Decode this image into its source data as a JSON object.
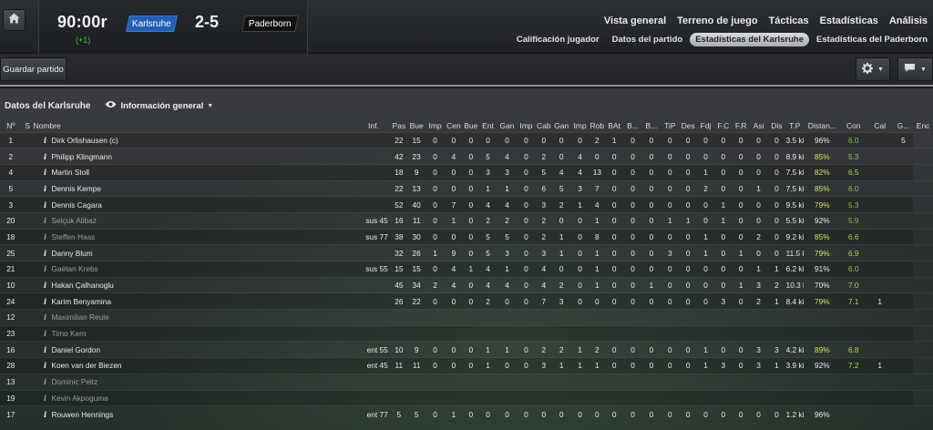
{
  "header": {
    "clock": "90:00r",
    "added_time": "(+1)",
    "home_team": "Karlsruhe",
    "away_team": "Paderborn",
    "score": "2-5",
    "main_nav": [
      "Vista general",
      "Terreno de juego",
      "Tácticas",
      "Estadísticas",
      "Análisis"
    ],
    "sub_nav": [
      "Calificación jugador",
      "Datos del partido",
      "Estadísticas del Karlsruhe",
      "Estadísticas del Paderborn"
    ],
    "active_sub_nav": "Estadísticas del Karlsruhe"
  },
  "toolbar": {
    "save_label": "Guardar partido"
  },
  "panel": {
    "title": "Datos del Karlsruhe",
    "view": "Información general"
  },
  "colors": {
    "home_team": "#1f5fb8",
    "away_team": "#111111",
    "added_time": "#45c43f",
    "rating": "#7ec84a"
  },
  "table": {
    "columns": [
      "Nº",
      "S",
      "Nombre",
      "Inf.",
      "Pas",
      "Bue",
      "Imp",
      "Cen",
      "Bue",
      "Ent",
      "Gan",
      "Imp",
      "Cab",
      "Gan",
      "Imp",
      "Rob",
      "BAt",
      "B...",
      "B...",
      "TiP",
      "Des",
      "Fdj",
      "F.C",
      "F.R",
      "Asi",
      "Dis",
      "T.P",
      "Distan...",
      "Con",
      "Cal",
      "G...",
      "Enc"
    ],
    "rows": [
      {
        "num": "1",
        "s": "",
        "name": "Dirk Orlishausen (c)",
        "info": "i",
        "inf": "",
        "stats": [
          "22",
          "15",
          "0",
          "0",
          "0",
          "0",
          "0",
          "0",
          "0",
          "0",
          "0",
          "2",
          "1",
          "0",
          "0",
          "0",
          "0",
          "0",
          "0",
          "0",
          "0",
          "0",
          "3.5 kiló...",
          "96%",
          "6.0",
          "",
          "5"
        ],
        "sub": false
      },
      {
        "num": "2",
        "s": "",
        "name": "Philipp Klingmann",
        "info": "i",
        "inf": "",
        "stats": [
          "42",
          "23",
          "0",
          "4",
          "0",
          "5",
          "4",
          "0",
          "2",
          "0",
          "4",
          "0",
          "0",
          "0",
          "0",
          "0",
          "0",
          "0",
          "0",
          "0",
          "0",
          "0",
          "8.9 kiló...",
          "85%",
          "5.3",
          "",
          ""
        ],
        "sub": false
      },
      {
        "num": "4",
        "s": "",
        "name": "Martin Stoll",
        "info": "i",
        "inf": "",
        "stats": [
          "18",
          "9",
          "0",
          "0",
          "0",
          "3",
          "3",
          "0",
          "5",
          "4",
          "4",
          "13",
          "0",
          "0",
          "0",
          "0",
          "0",
          "1",
          "0",
          "0",
          "0",
          "0",
          "7.5 kiló...",
          "82%",
          "6.5",
          "",
          ""
        ],
        "sub": false
      },
      {
        "num": "5",
        "s": "",
        "name": "Dennis Kempe",
        "info": "i",
        "inf": "",
        "stats": [
          "22",
          "13",
          "0",
          "0",
          "0",
          "1",
          "1",
          "0",
          "6",
          "5",
          "3",
          "7",
          "0",
          "0",
          "0",
          "0",
          "0",
          "2",
          "0",
          "0",
          "1",
          "0",
          "7.5 kiló...",
          "85%",
          "6.0",
          "",
          ""
        ],
        "sub": false
      },
      {
        "num": "3",
        "s": "",
        "name": "Dennis Cagara",
        "info": "i",
        "inf": "",
        "stats": [
          "52",
          "40",
          "0",
          "7",
          "0",
          "4",
          "4",
          "0",
          "3",
          "2",
          "1",
          "4",
          "0",
          "0",
          "0",
          "0",
          "0",
          "0",
          "1",
          "0",
          "0",
          "0",
          "9.5 kiló...",
          "79%",
          "5.3",
          "",
          ""
        ],
        "sub": false
      },
      {
        "num": "20",
        "s": "",
        "name": "Selçuk Alibaz",
        "info": "i",
        "inf": "sus 45",
        "stats": [
          "16",
          "11",
          "0",
          "1",
          "0",
          "2",
          "2",
          "0",
          "2",
          "0",
          "0",
          "1",
          "0",
          "0",
          "0",
          "1",
          "1",
          "0",
          "1",
          "0",
          "0",
          "0",
          "5.5 kiló...",
          "92%",
          "5.9",
          "",
          ""
        ],
        "sub": true
      },
      {
        "num": "18",
        "s": "",
        "name": "Steffen Haas",
        "info": "i",
        "inf": "sus 77",
        "stats": [
          "38",
          "30",
          "0",
          "0",
          "0",
          "5",
          "5",
          "0",
          "2",
          "1",
          "0",
          "8",
          "0",
          "0",
          "0",
          "0",
          "0",
          "1",
          "0",
          "0",
          "2",
          "0",
          "9.2 kiló...",
          "85%",
          "6.6",
          "",
          ""
        ],
        "sub": true
      },
      {
        "num": "25",
        "s": "",
        "name": "Danny Blum",
        "info": "i",
        "inf": "",
        "stats": [
          "32",
          "26",
          "1",
          "9",
          "0",
          "5",
          "3",
          "0",
          "3",
          "1",
          "0",
          "1",
          "0",
          "0",
          "0",
          "3",
          "0",
          "1",
          "0",
          "1",
          "0",
          "0",
          "11.5 kil...",
          "79%",
          "6.9",
          "",
          ""
        ],
        "sub": false
      },
      {
        "num": "21",
        "s": "",
        "name": "Gaëtan Krebs",
        "info": "i",
        "inf": "sus 55",
        "stats": [
          "15",
          "15",
          "0",
          "4",
          "1",
          "4",
          "1",
          "0",
          "4",
          "0",
          "0",
          "1",
          "0",
          "0",
          "0",
          "0",
          "0",
          "0",
          "0",
          "0",
          "1",
          "1",
          "6.2 kiló...",
          "91%",
          "6.0",
          "",
          ""
        ],
        "sub": true
      },
      {
        "num": "10",
        "s": "",
        "name": "Hakan Çalhanoglu",
        "info": "i",
        "inf": "",
        "stats": [
          "45",
          "34",
          "2",
          "4",
          "0",
          "4",
          "4",
          "0",
          "4",
          "2",
          "0",
          "1",
          "0",
          "0",
          "1",
          "0",
          "0",
          "0",
          "0",
          "1",
          "3",
          "2",
          "10.3 kil...",
          "70%",
          "7.0",
          "",
          ""
        ],
        "sub": false
      },
      {
        "num": "24",
        "s": "",
        "name": "Karim Benyamina",
        "info": "i",
        "inf": "",
        "stats": [
          "26",
          "22",
          "0",
          "0",
          "0",
          "2",
          "0",
          "0",
          "7",
          "3",
          "0",
          "0",
          "0",
          "0",
          "0",
          "0",
          "0",
          "0",
          "3",
          "0",
          "2",
          "1",
          "8.4 kiló...",
          "79%",
          "7.1",
          "1",
          ""
        ],
        "sub": false
      },
      {
        "num": "12",
        "s": "",
        "name": "Maximilian Reule",
        "info": "i",
        "inf": "",
        "stats": [
          "",
          "",
          "",
          "",
          "",
          "",
          "",
          "",
          "",
          "",
          "",
          "",
          "",
          "",
          "",
          "",
          "",
          "",
          "",
          "",
          "",
          "",
          "",
          "",
          "",
          "",
          ""
        ],
        "sub": true
      },
      {
        "num": "23",
        "s": "",
        "name": "Timo Kern",
        "info": "i",
        "inf": "",
        "stats": [
          "",
          "",
          "",
          "",
          "",
          "",
          "",
          "",
          "",
          "",
          "",
          "",
          "",
          "",
          "",
          "",
          "",
          "",
          "",
          "",
          "",
          "",
          "",
          "",
          "",
          "",
          ""
        ],
        "sub": true
      },
      {
        "num": "16",
        "s": "",
        "name": "Daniel Gordon",
        "info": "i",
        "inf": "ent 55",
        "stats": [
          "10",
          "9",
          "0",
          "0",
          "0",
          "1",
          "1",
          "0",
          "2",
          "2",
          "1",
          "2",
          "0",
          "0",
          "0",
          "0",
          "0",
          "1",
          "0",
          "0",
          "3",
          "3",
          "4.2 kiló...",
          "89%",
          "6.8",
          "",
          ""
        ],
        "sub": false
      },
      {
        "num": "28",
        "s": "",
        "name": "Koen van der Biezen",
        "info": "i",
        "inf": "ent 45",
        "stats": [
          "11",
          "11",
          "0",
          "0",
          "0",
          "1",
          "0",
          "0",
          "3",
          "1",
          "1",
          "1",
          "0",
          "0",
          "0",
          "0",
          "0",
          "1",
          "3",
          "0",
          "3",
          "1",
          "3.9 kiló...",
          "92%",
          "7.2",
          "1",
          ""
        ],
        "sub": false
      },
      {
        "num": "13",
        "s": "",
        "name": "Dominic Peitz",
        "info": "i",
        "inf": "",
        "stats": [
          "",
          "",
          "",
          "",
          "",
          "",
          "",
          "",
          "",
          "",
          "",
          "",
          "",
          "",
          "",
          "",
          "",
          "",
          "",
          "",
          "",
          "",
          "",
          "",
          "",
          "",
          ""
        ],
        "sub": true
      },
      {
        "num": "19",
        "s": "",
        "name": "Kevin Akpoguma",
        "info": "i",
        "inf": "",
        "stats": [
          "",
          "",
          "",
          "",
          "",
          "",
          "",
          "",
          "",
          "",
          "",
          "",
          "",
          "",
          "",
          "",
          "",
          "",
          "",
          "",
          "",
          "",
          "",
          "",
          "",
          "",
          ""
        ],
        "sub": true
      },
      {
        "num": "17",
        "s": "",
        "name": "Rouwen Hennings",
        "info": "i",
        "inf": "ent 77",
        "stats": [
          "5",
          "5",
          "0",
          "1",
          "0",
          "0",
          "0",
          "0",
          "0",
          "0",
          "0",
          "0",
          "0",
          "0",
          "0",
          "0",
          "0",
          "0",
          "0",
          "0",
          "0",
          "0",
          "1.2 kiló...",
          "96%",
          "",
          "",
          ""
        ],
        "sub": false
      }
    ]
  }
}
